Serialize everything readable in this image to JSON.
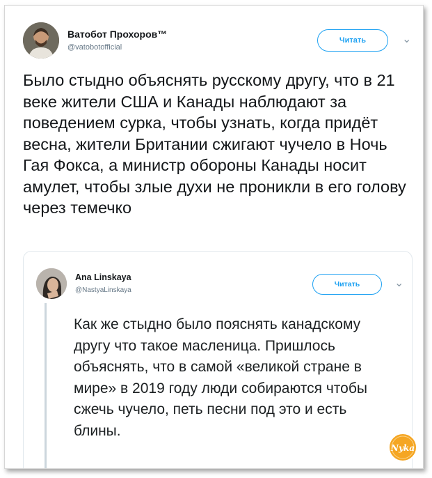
{
  "tweet": {
    "author_name": "Ватобот Прохоров™",
    "author_handle": "@vatobotofficial",
    "follow_label": "Читать",
    "text": "Было стыдно объяснять русскому другу, что в 21 веке жители США и Канады наблюдают за поведением сурка, чтобы узнать, когда придёт весна, жители Британии сжигают чучело в Ночь Гая Фокса, а министр обороны Канады носит амулет, чтобы злые духи не проникли в его голову через темечко"
  },
  "quoted_tweet": {
    "author_name": "Ana Linskaya",
    "author_handle": "@NastyaLinskaya",
    "follow_label": "Читать",
    "text": "Как же стыдно было пояснять канадскому другу что такое масленица. Пришлось объяснять, что в самой «великой стране в мире» в 2019 году люди собираются чтобы сжечь чучело, петь песни под это и есть блины."
  },
  "watermark": {
    "text": "Nyka"
  },
  "colors": {
    "accent": "#1da1f2",
    "watermark": "#f5a623"
  }
}
